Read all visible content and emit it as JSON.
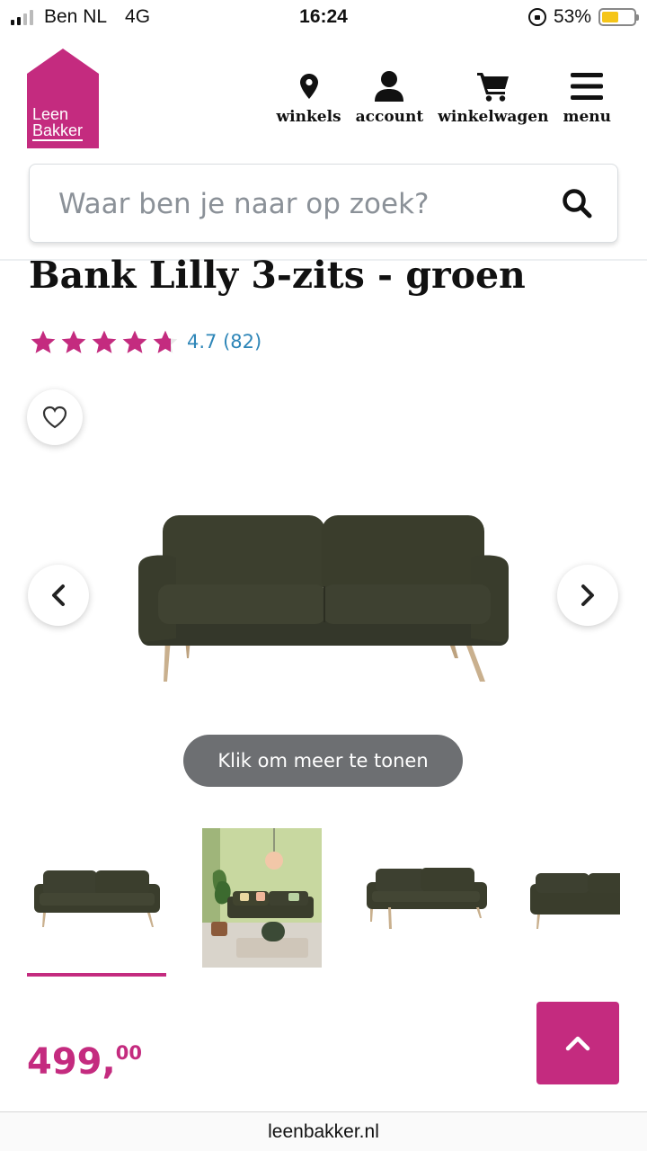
{
  "status_bar": {
    "carrier": "Ben NL",
    "network": "4G",
    "time": "16:24",
    "battery": "53%",
    "battery_level": 0.53
  },
  "header": {
    "logo_line1": "Leen",
    "logo_line2": "Bakker",
    "nav": [
      {
        "label": "winkels",
        "icon": "location-pin-icon"
      },
      {
        "label": "account",
        "icon": "user-icon"
      },
      {
        "label": "winkelwagen",
        "icon": "cart-icon"
      },
      {
        "label": "menu",
        "icon": "hamburger-menu-icon"
      }
    ],
    "search_placeholder": "Waar ben je naar op zoek?"
  },
  "product": {
    "title": "Bank Lilly 3-zits - groen",
    "rating_text": "4.7 (82)",
    "rating_value": 4.7,
    "stars_max": 5,
    "more_button": "Klik om meer te tonen",
    "price_main": "499,",
    "price_cents": "00",
    "thumbnails": [
      "sofa-front",
      "sofa-in-room",
      "sofa-angle",
      "sofa-side"
    ],
    "active_thumbnail": 0
  },
  "browser": {
    "url": "leenbakker.nl"
  },
  "colors": {
    "brand": "#c42b7f",
    "link": "#2e86b8",
    "sofa": "#3a3d2c"
  }
}
